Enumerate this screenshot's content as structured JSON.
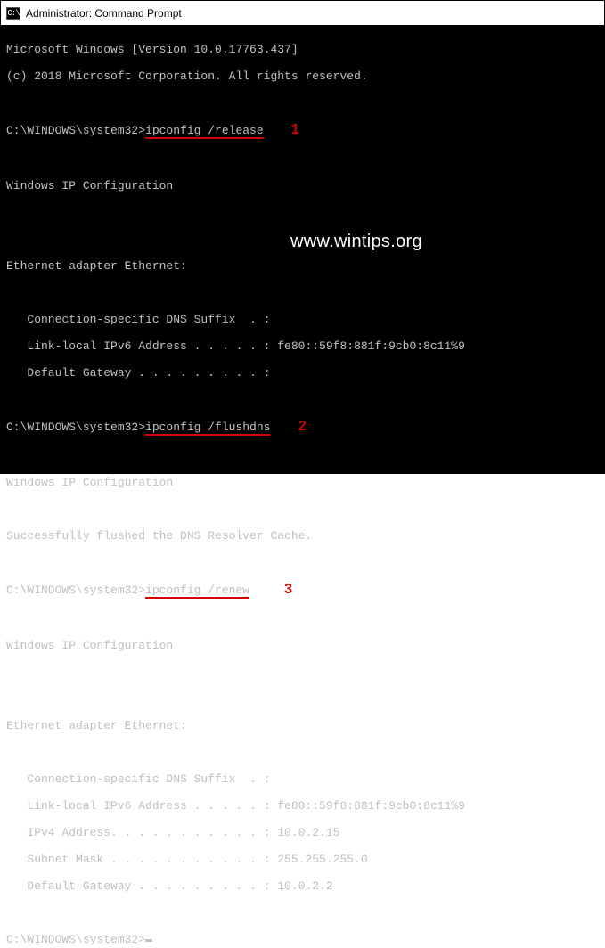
{
  "titlebar": {
    "icon_glyph": "C:\\",
    "title": "Administrator: Command Prompt"
  },
  "terminal": {
    "version_line": "Microsoft Windows [Version 10.0.17763.437]",
    "copyright_line": "(c) 2018 Microsoft Corporation. All rights reserved.",
    "prompt": "C:\\WINDOWS\\system32>",
    "cmd1": "ipconfig /release",
    "cmd2": "ipconfig /flushdns",
    "cmd3": "ipconfig /renew",
    "ip_config_header": "Windows IP Configuration",
    "ethernet_header": "Ethernet adapter Ethernet:",
    "dns_suffix": "   Connection-specific DNS Suffix  . :",
    "ipv6_line1": "   Link-local IPv6 Address . . . . . : fe80::59f8:881f:9cb0:8c11%9",
    "gateway_line1": "   Default Gateway . . . . . . . . . :",
    "flush_success": "Successfully flushed the DNS Resolver Cache.",
    "ipv6_line2": "   Link-local IPv6 Address . . . . . : fe80::59f8:881f:9cb0:8c11%9",
    "ipv4_line": "   IPv4 Address. . . . . . . . . . . : 10.0.2.15",
    "subnet_line": "   Subnet Mask . . . . . . . . . . . : 255.255.255.0",
    "gateway_line2": "   Default Gateway . . . . . . . . . : 10.0.2.2"
  },
  "annotations": {
    "num1": "1",
    "num2": "2",
    "num3": "3",
    "watermark": "www.wintips.org"
  }
}
